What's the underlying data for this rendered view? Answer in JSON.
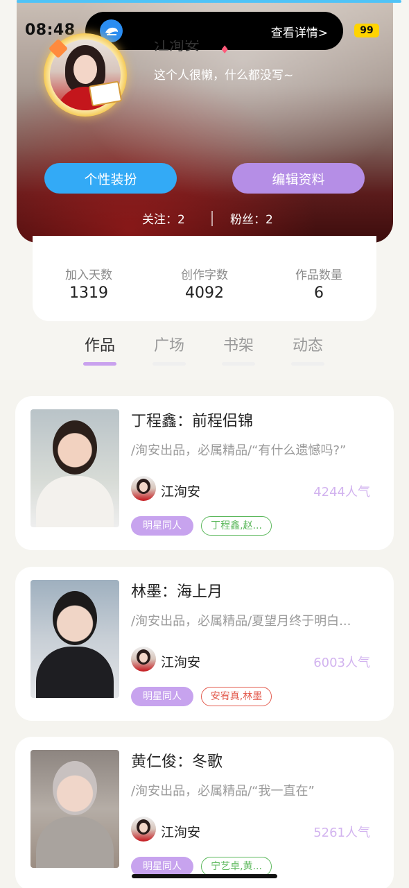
{
  "status": {
    "time": "08:48",
    "battery": "99"
  },
  "island": {
    "link_label": "查看详情>"
  },
  "profile": {
    "name": "江洵安",
    "bio": "这个人很懒，什么都没写~",
    "decorate_button": "个性装扮",
    "edit_button": "编辑资料",
    "follow_text": "关注：2",
    "fans_text": "粉丝：2"
  },
  "stats": [
    {
      "label": "加入天数",
      "value": "1319"
    },
    {
      "label": "创作字数",
      "value": "4092"
    },
    {
      "label": "作品数量",
      "value": "6"
    }
  ],
  "tabs": [
    "作品",
    "广场",
    "书架",
    "动态"
  ],
  "active_tab": 0,
  "works": [
    {
      "title": "丁程鑫：前程侣锦",
      "desc": "/洵安出品，必属精品/“有什么遗憾吗?”",
      "author": "江洵安",
      "popularity": "4244人气",
      "genre": "明星同人",
      "cp": "丁程鑫,赵...",
      "cp_color": "#5cb85c"
    },
    {
      "title": "林墨：海上月",
      "desc": "/洵安出品，必属精品/夏望月终于明白...",
      "author": "江洵安",
      "popularity": "6003人气",
      "genre": "明星同人",
      "cp": "安宥真,林墨",
      "cp_color": "#e35d50"
    },
    {
      "title": "黄仁俊：冬歌",
      "desc": "/洵安出品，必属精品/“我一直在”",
      "author": "江洵安",
      "popularity": "5261人气",
      "genre": "明星同人",
      "cp": "宁艺卓,黄...",
      "cp_color": "#5cb85c"
    }
  ],
  "colors": {
    "accent_purple": "#b58ee6",
    "accent_blue": "#33aaf6",
    "popularity": "#d2b3ef"
  }
}
